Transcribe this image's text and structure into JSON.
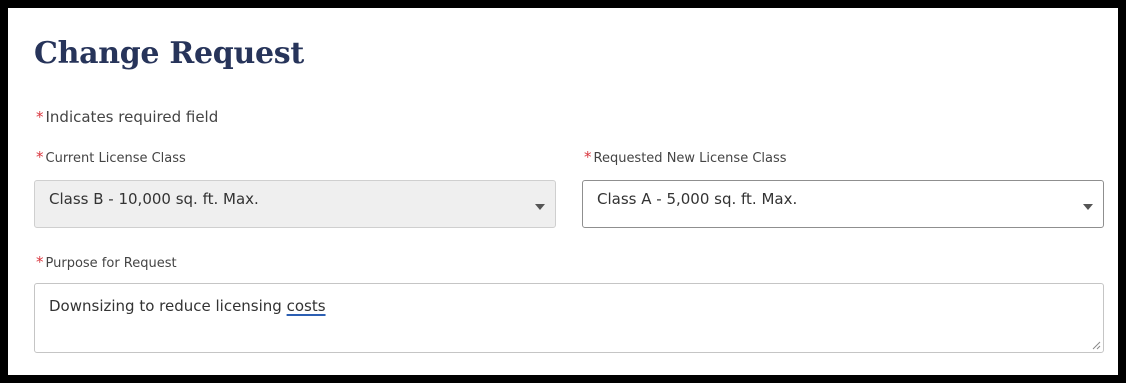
{
  "form": {
    "title": "Change Request",
    "required_marker": "*",
    "required_note": "Indicates required field"
  },
  "fields": {
    "current_license_class": {
      "label": "Current License Class",
      "value": "Class B - 10,000 sq. ft. Max.",
      "disabled": true
    },
    "requested_license_class": {
      "label": "Requested New License Class",
      "value": "Class A - 5,000 sq. ft. Max."
    },
    "purpose": {
      "label": "Purpose for Request",
      "value_prefix": "Downsizing to reduce licensing ",
      "value_flagged_word": "costs"
    }
  },
  "icons": {
    "dropdown": "chevron-down-icon",
    "resize": "resize-handle-icon"
  },
  "colors": {
    "required": "#d9363e",
    "title": "#27345a",
    "disabled_bg": "#efefef"
  }
}
